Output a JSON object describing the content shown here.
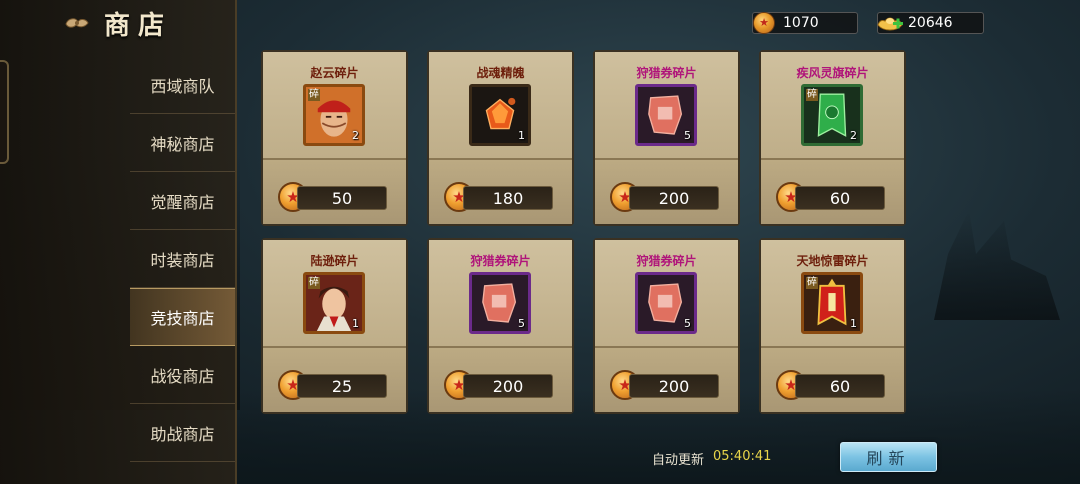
{
  "header": {
    "title": "商店",
    "back_icon": "cloud-back-icon"
  },
  "sidebar": {
    "items": [
      {
        "label": "西域商队",
        "active": false
      },
      {
        "label": "神秘商店",
        "active": false
      },
      {
        "label": "觉醒商店",
        "active": false
      },
      {
        "label": "时装商店",
        "active": false
      },
      {
        "label": "竞技商店",
        "active": true
      },
      {
        "label": "战役商店",
        "active": false
      },
      {
        "label": "助战商店",
        "active": false
      }
    ]
  },
  "currency": {
    "gold": "1070",
    "ingot": "20646",
    "gold_icon": "gold-coin-icon",
    "ingot_icon": "ingot-add-icon"
  },
  "items": [
    {
      "name": "赵云碎片",
      "qty": "2",
      "price": "50",
      "shard_tag": "碎",
      "name_color": "red",
      "icon": "zhaoyun-portrait-icon"
    },
    {
      "name": "战魂精魄",
      "qty": "1",
      "price": "180",
      "shard_tag": "",
      "name_color": "red",
      "icon": "red-crystal-icon"
    },
    {
      "name": "狩猎券碎片",
      "qty": "5",
      "price": "200",
      "shard_tag": "",
      "name_color": "purple",
      "icon": "hunting-ticket-icon"
    },
    {
      "name": "疾风灵旗碎片",
      "qty": "2",
      "price": "60",
      "shard_tag": "碎",
      "name_color": "purple",
      "icon": "green-banner-icon"
    },
    {
      "name": "陆逊碎片",
      "qty": "1",
      "price": "25",
      "shard_tag": "碎",
      "name_color": "red",
      "icon": "luxun-portrait-icon"
    },
    {
      "name": "狩猎券碎片",
      "qty": "5",
      "price": "200",
      "shard_tag": "",
      "name_color": "purple",
      "icon": "hunting-ticket-icon"
    },
    {
      "name": "狩猎券碎片",
      "qty": "5",
      "price": "200",
      "shard_tag": "",
      "name_color": "purple",
      "icon": "hunting-ticket-icon"
    },
    {
      "name": "天地惊雷碎片",
      "qty": "1",
      "price": "60",
      "shard_tag": "碎",
      "name_color": "red",
      "icon": "thunder-banner-icon"
    }
  ],
  "footer": {
    "auto_refresh_label": "自动更新",
    "refresh_time": "05:40:41",
    "refresh_button": "刷新"
  },
  "colors": {
    "price_text": "#ffffff",
    "timer": "#e7d54a",
    "refresh_button": "#7cc3e3"
  }
}
